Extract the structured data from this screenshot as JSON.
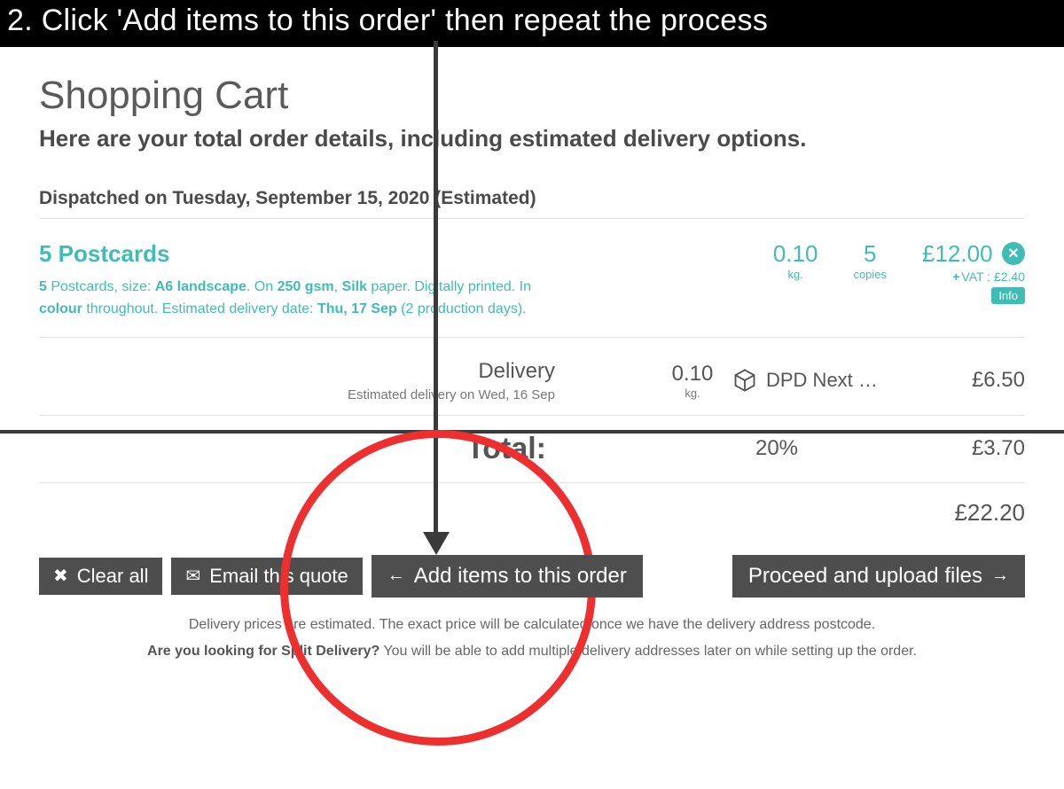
{
  "instruction": "2. Click 'Add items to this order' then repeat the process",
  "cart": {
    "title": "Shopping Cart",
    "subtitle": "Here are your total order details, including estimated delivery options.",
    "dispatch": "Dispatched on Tuesday, September 15, 2020 (Estimated)"
  },
  "item": {
    "title": "5 Postcards",
    "desc_qty": "5",
    "desc_text1": " Postcards, size: ",
    "desc_size": "A6 landscape",
    "desc_text2": ". On ",
    "desc_gsm": "250 gsm",
    "desc_text3": ", ",
    "desc_finish": "Silk",
    "desc_text4": " paper. Digitally printed. In ",
    "desc_colour": "colour",
    "desc_text5": " throughout. Estimated delivery date: ",
    "desc_date": "Thu, 17 Sep",
    "desc_text6": " (2 production days).",
    "weight_val": "0.10",
    "weight_unit": "kg.",
    "copies_val": "5",
    "copies_unit": "copies",
    "price": "£12.00",
    "vat_label": "VAT : £2.40",
    "info": "Info"
  },
  "delivery": {
    "label": "Delivery",
    "estimate": "Estimated delivery on Wed, 16 Sep",
    "weight_val": "0.10",
    "weight_unit": "kg.",
    "carrier": "DPD Next …",
    "price": "£6.50"
  },
  "totals": {
    "label": "Total:",
    "vat_pct": "20%",
    "vat_amount": "£3.70",
    "grand": "£22.20"
  },
  "buttons": {
    "clear": "Clear all",
    "email": "Email this quote",
    "add": "Add items to this order",
    "proceed": "Proceed and upload files"
  },
  "footer": {
    "line1a": "Delivery prices are estimated. The exact price will be calculated once we have the delivery address postcode.",
    "line2a": "Are you looking for Split Delivery?",
    "line2b": " You will be able to add multiple delivery addresses later on while setting up the order."
  }
}
